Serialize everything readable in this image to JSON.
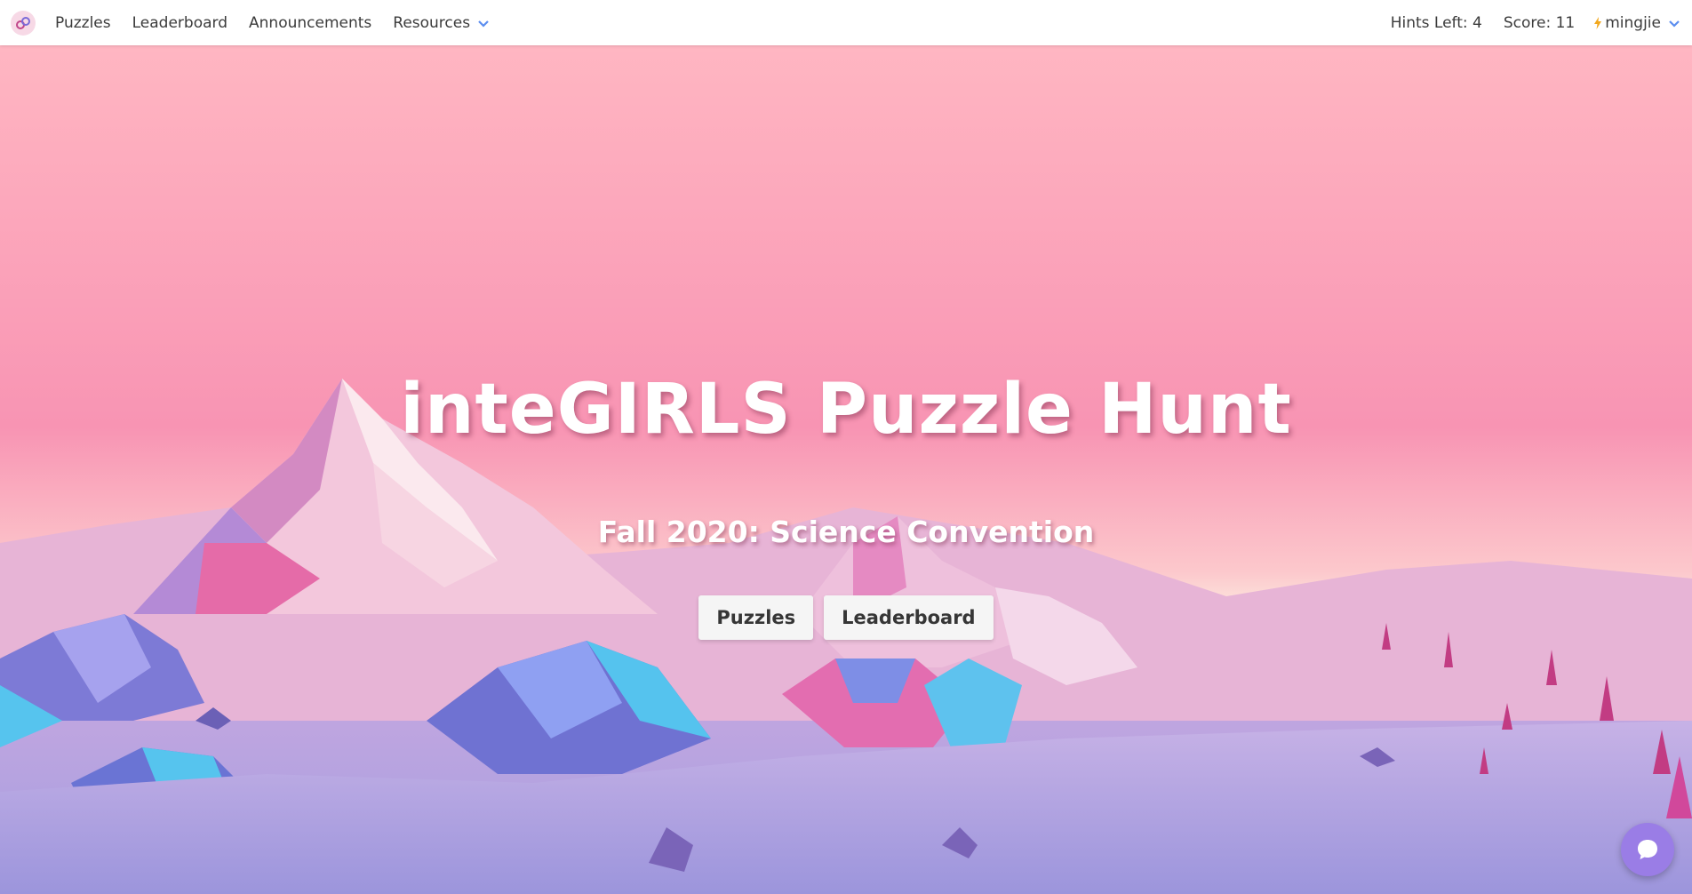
{
  "nav": {
    "logo_icon": "integirls-logo-icon",
    "items": [
      {
        "label": "Puzzles"
      },
      {
        "label": "Leaderboard"
      },
      {
        "label": "Announcements"
      },
      {
        "label": "Resources"
      }
    ],
    "hints": "Hints Left: 4",
    "score": "Score: 11",
    "username": "mingjie",
    "user_icon": "lightning-icon",
    "dropdown_icon": "chevron-down-icon"
  },
  "hero": {
    "title": "inteGIRLS Puzzle Hunt",
    "subtitle": "Fall 2020: Science Convention",
    "buttons": [
      {
        "label": "Puzzles"
      },
      {
        "label": "Leaderboard"
      }
    ]
  },
  "chat": {
    "icon": "chat-bubble-icon"
  },
  "colors": {
    "accent": "#9a7de6",
    "chevron": "#5b8def",
    "lightning": "#f2a81d",
    "sky_top": "#ffb6c2",
    "sky_mid": "#f88fb0",
    "ground": "#a79ce0"
  }
}
